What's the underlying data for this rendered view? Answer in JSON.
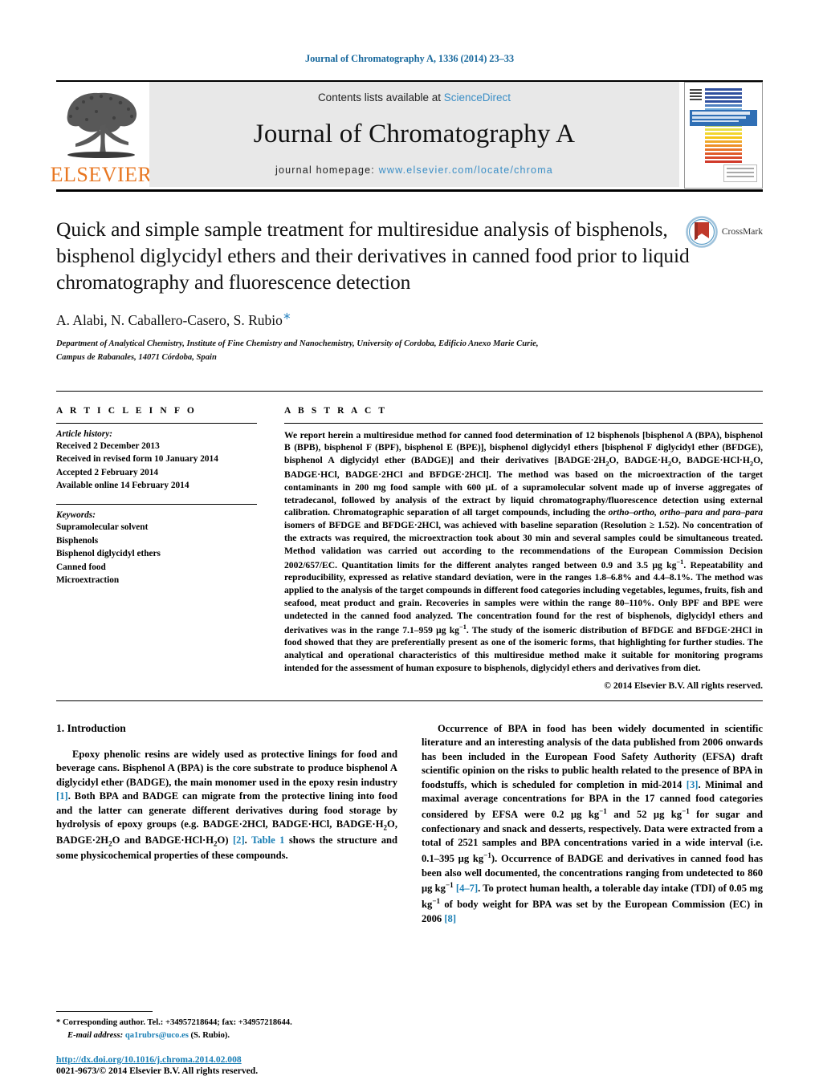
{
  "running_head": "Journal of Chromatography A, 1336 (2014) 23–33",
  "masthead": {
    "publisher_name": "ELSEVIER",
    "contents_prefix": "Contents lists available at ",
    "sciencedirect": "ScienceDirect",
    "journal_title": "Journal of Chromatography A",
    "homepage_prefix": "journal homepage: ",
    "homepage_url": "www.elsevier.com/locate/chroma",
    "cover_bar_colors": [
      "#2f4f9e",
      "#2f4f9e",
      "#2f4f9e",
      "#2f4f9e",
      "#4f7fc0",
      "#6ea8d8",
      "#7fb3c9",
      "#74b49b",
      "#8cc06f",
      "#b9cf5f",
      "#e6e04a",
      "#f2d62e",
      "#f5c518",
      "#f0a92a",
      "#ee8f27",
      "#e8742a",
      "#e05a28",
      "#d94a2a",
      "#d13a2a"
    ],
    "band_color": "#2f6fb5"
  },
  "article": {
    "crossmark_label": "CrossMark",
    "title": "Quick and simple sample treatment for multiresidue analysis of bisphenols, bisphenol diglycidyl ethers and their derivatives in canned food prior to liquid chromatography and fluorescence detection",
    "authors": "A. Alabi, N. Caballero-Casero, S. Rubio",
    "corresponding_marker": "∗",
    "affiliation_line1": "Department of Analytical Chemistry, Institute of Fine Chemistry and Nanochemistry, University of Cordoba, Edificio Anexo Marie Curie,",
    "affiliation_line2": "Campus de Rabanales, 14071 Córdoba, Spain"
  },
  "article_info": {
    "label": "A R T I C L E   I N F O",
    "history_heading": "Article history:",
    "history": [
      "Received 2 December 2013",
      "Received in revised form 10 January 2014",
      "Accepted 2 February 2014",
      "Available online 14 February 2014"
    ],
    "keywords_heading": "Keywords:",
    "keywords": [
      "Supramolecular solvent",
      "Bisphenols",
      "Bisphenol diglycidyl ethers",
      "Canned food",
      "Microextraction"
    ]
  },
  "abstract": {
    "label": "A B S T R A C T",
    "part1": "We report herein a multiresidue method for canned food determination of 12 bisphenols [bisphenol A (BPA), bisphenol B (BPB), bisphenol F (BPF), bisphenol E (BPE)], bisphenol diglycidyl ethers [bisphenol F diglycidyl ether (BFDGE), bisphenol A diglycidyl ether (BADGE)] and their derivatives [BADGE·2H",
    "part2": "O, BADGE·H",
    "part3": "O, BADGE·HCl·H",
    "part4": "O, BADGE·HCl, BADGE·2HCl and BFDGE·2HCl]. The method was based on the microextraction of the target contaminants in 200 mg food sample with 600 μL of a supramolecular solvent made up of inverse aggregates of tetradecanol, followed by analysis of the extract by liquid chromatography/fluorescence detection using external calibration. Chromatographic separation of all target compounds, including the ",
    "italic1": "ortho–ortho, ortho–para and para–para",
    "part5": " isomers of BFDGE and BFDGE·2HCl, was achieved with baseline separation (Resolution ≥ 1.52). No concentration of the extracts was required, the microextraction took about 30 min and several samples could be simultaneous treated. Method validation was carried out according to the recommendations of the European Commission Decision 2002/657/EC. Quantitation limits for the different analytes ranged between 0.9 and 3.5 μg kg",
    "sup1": "−1",
    "part6": ". Repeatability and reproducibility, expressed as relative standard deviation, were in the ranges 1.8–6.8% and 4.4–8.1%. The method was applied to the analysis of the target compounds in different food categories including vegetables, legumes, fruits, fish and seafood, meat product and grain. Recoveries in samples were within the range 80–110%. Only BPF and BPE were undetected in the canned food analyzed. The concentration found for the rest of bisphenols, diglycidyl ethers and derivatives was in the range 7.1–959 μg kg",
    "sup2": "−1",
    "part7": ". The study of the isomeric distribution of BFDGE and BFDGE·2HCl in food showed that they are preferentially present as one of the isomeric forms, that highlighting for further studies. The analytical and operational characteristics of this multiresidue method make it suitable for monitoring programs intended for the assessment of human exposure to bisphenols, diglycidyl ethers and derivatives from diet.",
    "copyright": "© 2014 Elsevier B.V. All rights reserved."
  },
  "introduction": {
    "heading": "1.  Introduction",
    "left_p1_a": "Epoxy phenolic resins are widely used as protective linings for food and beverage cans. Bisphenol A (BPA) is the core substrate to produce bisphenol A diglycidyl ether (BADGE), the main monomer used in the epoxy resin industry ",
    "left_ref1": "[1]",
    "left_p1_b": ". Both BPA and BADGE can migrate from the protective lining into food and the latter can generate different derivatives during food storage by hydrolysis of epoxy groups (e.g. BADGE·2HCl, BADGE·HCl, BADGE·H",
    "left_p1_c": "O, BADGE·2H",
    "left_p1_d": "O and BADGE·HCl·H",
    "left_p1_e": "O) ",
    "left_ref2": "[2]",
    "left_p1_f": ". ",
    "left_tablelink": "Table 1",
    "left_p1_g": " shows the structure and some physicochemical properties of these compounds.",
    "right_p1_a": "Occurrence of BPA in food has been widely documented in scientific literature and an interesting analysis of the data published from 2006 onwards has been included in the European Food Safety Authority (EFSA) draft scientific opinion on the risks to public health related to the presence of BPA in foodstuffs, which is scheduled for completion in mid-2014 ",
    "right_ref3": "[3]",
    "right_p1_b": ". Minimal and maximal average concentrations for BPA in the 17 canned food categories considered by EFSA were 0.2 μg kg",
    "right_sup1": "−1",
    "right_p1_c": " and 52 μg kg",
    "right_sup2": "−1",
    "right_p1_d": " for sugar and confectionary and snack and desserts, respectively. Data were extracted from a total of 2521 samples and BPA concentrations varied in a wide interval (i.e. 0.1–395 μg kg",
    "right_sup3": "−1",
    "right_p1_e": "). Occurrence of BADGE and derivatives in canned food has been also well documented, the concentrations ranging from undetected to 860 μg kg",
    "right_sup4": "−1",
    "right_p1_f": " ",
    "right_ref47": "[4–7]",
    "right_p1_g": ". To protect human health, a tolerable day intake (TDI) of 0.05 mg kg",
    "right_sup5": "−1",
    "right_p1_h": " of body weight for BPA was set by the European Commission (EC) in 2006 ",
    "right_ref8": "[8]"
  },
  "footer": {
    "corresponding_marker": "*",
    "corresponding_text": " Corresponding author. Tel.: +34957218644; fax: +34957218644.",
    "email_label": "E-mail address:",
    "email": "qa1rubrs@uco.es",
    "email_suffix": " (S. Rubio).",
    "doi": "http://dx.doi.org/10.1016/j.chroma.2014.02.008",
    "issn_line": "0021-9673/© 2014 Elsevier B.V. All rights reserved."
  },
  "colors": {
    "link_blue": "#1a7fb5",
    "sciencedirect_blue": "#3b8ec6",
    "elsevier_orange": "#E87722"
  }
}
